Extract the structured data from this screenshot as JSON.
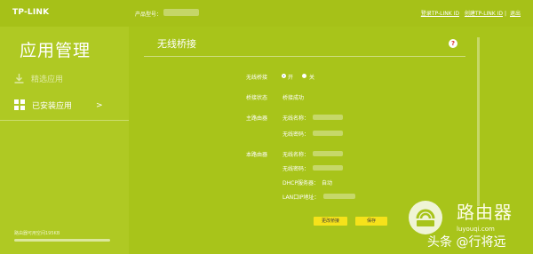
{
  "header": {
    "logo": "TP-LINK",
    "model_label": "产品型号：",
    "links": {
      "login": "登录TP-LINK ID",
      "create": "创建TP-LINK ID",
      "sep": "|",
      "logout": "退出"
    }
  },
  "sidebar": {
    "title": "应用管理",
    "items": [
      {
        "label": "精选应用",
        "icon": "download-icon"
      },
      {
        "label": "已安装应用",
        "icon": "grid-icon",
        "chevron": ">"
      }
    ],
    "storage_text": "路由器可用空间195KB"
  },
  "main": {
    "title": "无线桥接",
    "help": "?",
    "bridge_toggle": {
      "label": "无线桥接",
      "on": "开",
      "off": "关"
    },
    "bridge_status": {
      "label": "桥接状态",
      "value": "桥接成功"
    },
    "main_router": {
      "label": "主路由器",
      "fields": [
        {
          "label": "无线名称："
        },
        {
          "label": "无线密码："
        }
      ]
    },
    "this_router": {
      "label": "本路由器",
      "fields": [
        {
          "label": "无线名称："
        },
        {
          "label": "无线密码："
        },
        {
          "label": "DHCP服务器：",
          "value": "自动"
        },
        {
          "label": "LAN口IP地址："
        }
      ]
    },
    "buttons": {
      "change": "更改桥接",
      "save": "保存"
    }
  },
  "watermark": {
    "name": "路由器",
    "site": "luyouqi.com",
    "handle": "头条 @行将远"
  }
}
